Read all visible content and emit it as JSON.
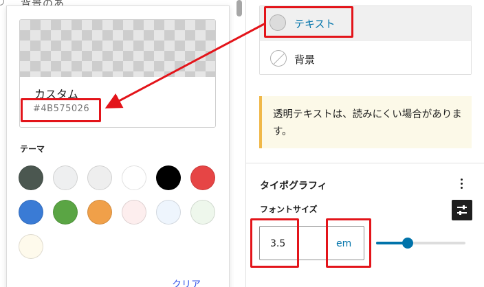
{
  "background_text": "背景のあ",
  "color_picker": {
    "custom_label": "カスタム",
    "custom_hex": "#4B575026",
    "theme_label": "テーマ",
    "clear_label": "クリア",
    "theme_colors": [
      {
        "name": "dark-slate",
        "hex": "#4b5750"
      },
      {
        "name": "light-grey-1",
        "hex": "#eeeff0"
      },
      {
        "name": "light-grey-2",
        "hex": "#eeeeee"
      },
      {
        "name": "white",
        "hex": "#ffffff"
      },
      {
        "name": "black",
        "hex": "#000000"
      },
      {
        "name": "red",
        "hex": "#e64545"
      },
      {
        "name": "blue",
        "hex": "#3a7bd5"
      },
      {
        "name": "green",
        "hex": "#5aa544"
      },
      {
        "name": "orange",
        "hex": "#f0a049"
      },
      {
        "name": "pale-pink",
        "hex": "#fdeeee"
      },
      {
        "name": "pale-blue",
        "hex": "#eef5fd"
      },
      {
        "name": "pale-green",
        "hex": "#eef7ec"
      },
      {
        "name": "pale-cream",
        "hex": "#fefaec"
      }
    ]
  },
  "color_settings": {
    "text_label": "テキスト",
    "background_label": "背景"
  },
  "notice": {
    "text": "透明テキストは、読みにくい場合があります。"
  },
  "typography": {
    "title": "タイポグラフィ",
    "font_size_label": "フォントサイズ",
    "font_size_value": "3.5",
    "font_size_unit": "em",
    "slider_fraction": 0.35
  },
  "colors": {
    "accent": "#0073aa",
    "annotation_red": "#e3141a",
    "notice_border": "#f0b849"
  }
}
